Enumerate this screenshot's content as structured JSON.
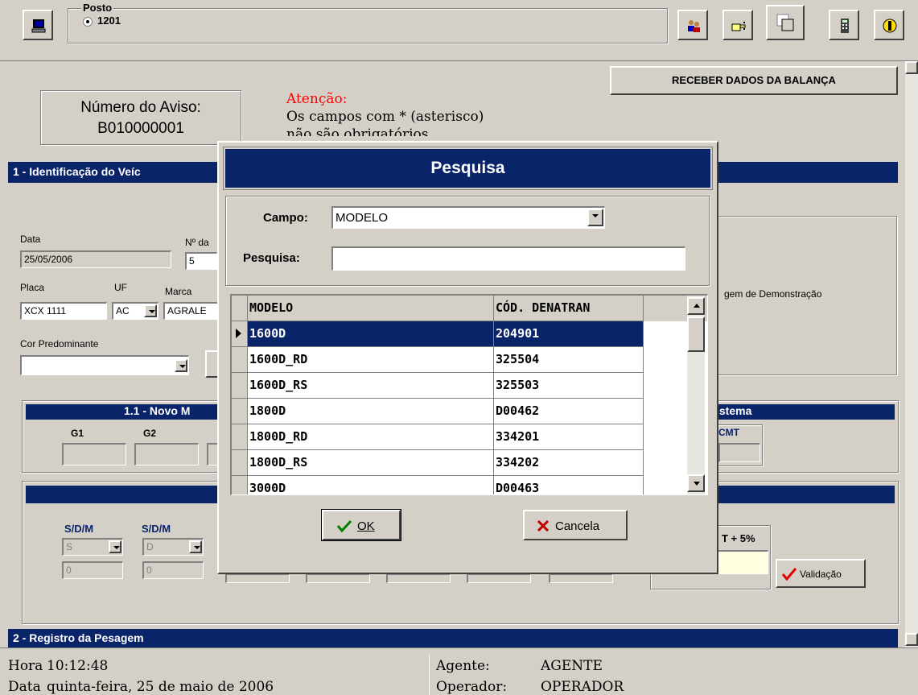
{
  "toolbar": {
    "posto_label": "Posto",
    "posto_value": "1201",
    "icons": [
      "computer-icon",
      "users-icon",
      "hand-pointer-icon",
      "copy-windows-icon",
      "calculator-icon",
      "exit-icon"
    ]
  },
  "receber_button": "RECEBER DADOS DA BALANÇA",
  "aviso": {
    "label": "Número do Aviso:",
    "value": "B010000001"
  },
  "atencao": {
    "title": "Atenção:",
    "line1": "Os campos com * (asterisco)",
    "line2": "não são obrigatórios"
  },
  "section1": {
    "title": "1 - Identificação do Veíc"
  },
  "form": {
    "data_label": "Data",
    "data_value": "25/05/2006",
    "nro_label": "Nº da",
    "nro_value": "5",
    "placa_label": "Placa",
    "placa_value": "XCX 1111",
    "uf_label": "UF",
    "uf_value": "AC",
    "marca_label": "Marca",
    "marca_value": "AGRALE",
    "cor_label": "Cor Predominante",
    "cor_value": "",
    "demo_text": "gem de Demonstração"
  },
  "section11": {
    "title": "1.1 - Novo M",
    "g1": "G1",
    "g2": "G2",
    "sistema": "istema",
    "cmt": "CMT"
  },
  "section12": {
    "sdm1": "S/D/M",
    "sdm2": "S/D/M",
    "sel1": "S",
    "sel2": "D",
    "val1": "0",
    "val2": "0",
    "t5": "T + 5%",
    "validacao": "Validação"
  },
  "section2": {
    "title": "2 - Registro da Pesagem"
  },
  "status": {
    "hora_label": "Hora",
    "hora_value": "10:12:48",
    "data_label": "Data",
    "data_value": "quinta-feira, 25 de maio de 2006",
    "agente_label": "Agente:",
    "agente_value": "AGENTE",
    "operador_label": "Operador:",
    "operador_value": "OPERADOR"
  },
  "dialog": {
    "title": "Pesquisa",
    "campo_label": "Campo:",
    "campo_value": "MODELO",
    "pesquisa_label": "Pesquisa:",
    "pesquisa_value": "",
    "columns": [
      "MODELO",
      "CÓD. DENATRAN"
    ],
    "rows": [
      [
        "1600D",
        "204901"
      ],
      [
        "1600D_RD",
        "325504"
      ],
      [
        "1600D_RS",
        "325503"
      ],
      [
        "1800D",
        "D00462"
      ],
      [
        "1800D_RD",
        "334201"
      ],
      [
        "1800D_RS",
        "334202"
      ],
      [
        "3000D",
        "D00463"
      ]
    ],
    "selected_row": 0,
    "ok_label": "OK",
    "cancel_label": "Cancela"
  },
  "colors": {
    "titlebar": "#0a246a",
    "face": "#d4d0c8",
    "alert": "#ff0000",
    "label_blue": "#0a246a"
  }
}
